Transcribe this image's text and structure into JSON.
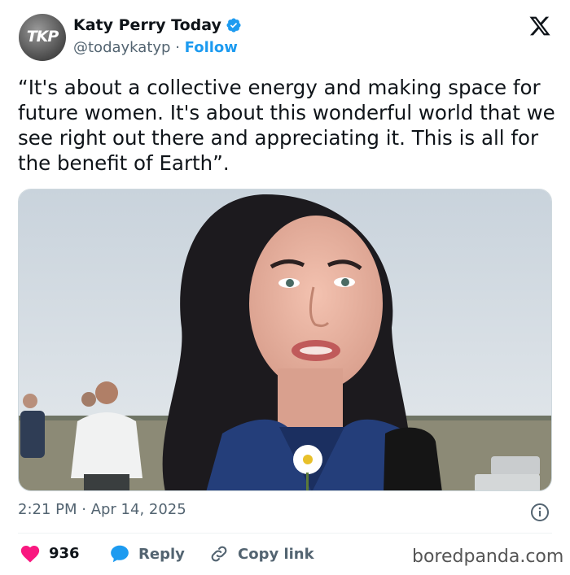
{
  "author": {
    "name": "Katy Perry Today",
    "handle": "@todaykatyp",
    "separator": "·",
    "follow_label": "Follow",
    "avatar_text": "TKP"
  },
  "tweet": {
    "text": "“It's about a collective energy and making space for future women. It's about this wonderful world that we see right out there and appreciating it. This is all for the benefit of Earth”.",
    "time": "2:21 PM · Apr 14, 2025"
  },
  "actions": {
    "like_count": "936",
    "reply_label": "Reply",
    "copy_link_label": "Copy link"
  },
  "watermark": "boredpanda.com",
  "icons": {
    "verified": "verified-badge-icon",
    "x_logo": "x-logo-icon",
    "info": "info-icon",
    "heart": "heart-icon",
    "reply": "speech-bubble-icon",
    "link": "link-icon"
  },
  "colors": {
    "accent": "#1d9bf0",
    "like": "#f91880",
    "text": "#0f1419",
    "muted": "#536471"
  }
}
